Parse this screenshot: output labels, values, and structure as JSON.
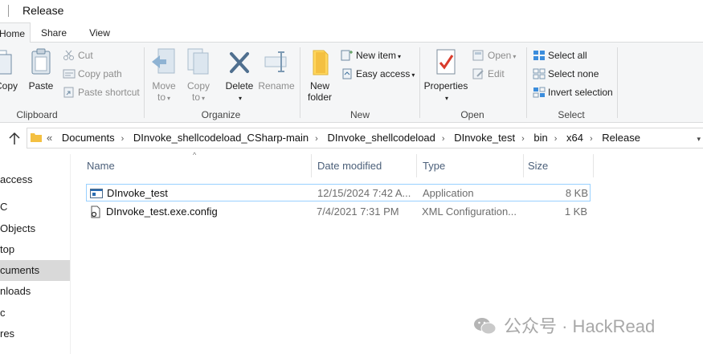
{
  "window": {
    "title": "Release"
  },
  "ribbon_tabs": [
    "Home",
    "Share",
    "View"
  ],
  "ribbon": {
    "clipboard": {
      "label": "Clipboard",
      "copy": "Copy",
      "paste": "Paste",
      "cut": "Cut",
      "copy_path": "Copy path",
      "paste_shortcut": "Paste shortcut"
    },
    "organize": {
      "label": "Organize",
      "move_to_1": "Move",
      "move_to_2": "to",
      "copy_to_1": "Copy",
      "copy_to_2": "to",
      "delete": "Delete",
      "rename": "Rename"
    },
    "new": {
      "label": "New",
      "new_folder_1": "New",
      "new_folder_2": "folder",
      "new_item": "New item",
      "easy_access": "Easy access"
    },
    "open": {
      "label": "Open",
      "properties": "Properties",
      "open": "Open",
      "edit": "Edit"
    },
    "select": {
      "label": "Select",
      "select_all": "Select all",
      "select_none": "Select none",
      "invert_selection": "Invert selection"
    }
  },
  "address_bar": {
    "overflow": "«",
    "crumbs": [
      "Documents",
      "DInvoke_shellcodeload_CSharp-main",
      "DInvoke_shellcodeload",
      "DInvoke_test",
      "bin",
      "x64",
      "Release"
    ]
  },
  "nav_pane": {
    "items": [
      "access",
      "C",
      "Objects",
      "top",
      "cuments",
      "nloads",
      "c",
      "res"
    ],
    "selected_index": 4
  },
  "columns": {
    "name": "Name",
    "date": "Date modified",
    "type": "Type",
    "size": "Size"
  },
  "files": [
    {
      "name": "DInvoke_test",
      "date": "12/15/2024 7:42 A...",
      "type": "Application",
      "size": "8 KB",
      "icon": "application-icon"
    },
    {
      "name": "DInvoke_test.exe.config",
      "date": "7/4/2021 7:31 PM",
      "type": "XML Configuration...",
      "size": "1 KB",
      "icon": "config-file-icon"
    }
  ],
  "watermark": {
    "text": "公众号 · HackRead"
  },
  "colors": {
    "accent": "#1979ca",
    "selection": "#99d1ff",
    "folder": "#f4c041"
  }
}
